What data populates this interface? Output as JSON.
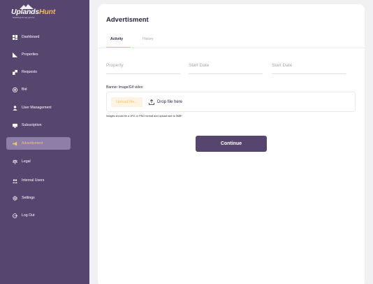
{
  "brand": {
    "name_part1": "Uplands",
    "name_part2": "Hunt",
    "tagline": "Redefining the way you hunt",
    "accent_color": "#f2b84b",
    "sidebar_color": "#56456f"
  },
  "sidebar": {
    "items": [
      {
        "label": "Dashboard",
        "icon": "dashboard-icon",
        "active": false
      },
      {
        "label": "Properties",
        "icon": "properties-icon",
        "active": false
      },
      {
        "label": "Requests",
        "icon": "requests-icon",
        "active": false
      },
      {
        "label": "Bid",
        "icon": "bid-icon",
        "active": false
      },
      {
        "label": "User Management",
        "icon": "user-icon",
        "active": false
      },
      {
        "label": "Subscription",
        "icon": "subscription-icon",
        "active": false
      },
      {
        "label": "Advertisment",
        "icon": "megaphone-icon",
        "active": true
      },
      {
        "label": "Legal",
        "icon": "scale-icon",
        "active": false
      },
      {
        "label": "Internal Users",
        "icon": "users-icon",
        "active": false
      },
      {
        "label": "Settings",
        "icon": "gear-icon",
        "active": false
      },
      {
        "label": "Log Out",
        "icon": "logout-icon",
        "active": false
      }
    ]
  },
  "main": {
    "title": "Advertisment",
    "tabs": [
      {
        "label": "Activity",
        "active": true
      },
      {
        "label": "History",
        "active": false
      }
    ],
    "fields": {
      "property_placeholder": "Property",
      "start_date_placeholder": "Start Date",
      "end_date_placeholder": "Start Date"
    },
    "banner_label": "Banner Image/Gif video",
    "upload_button": "Upload file...",
    "drop_text": "Drop file here",
    "hint": "Images should be a JPG or PNG format and upload size is 5MB*",
    "continue_label": "Continue"
  }
}
